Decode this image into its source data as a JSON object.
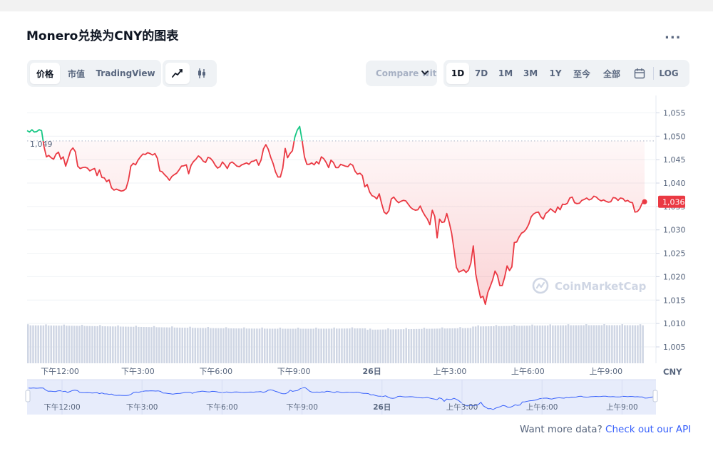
{
  "header": {
    "title": "Monero兑换为CNY的图表",
    "more_label": "..."
  },
  "toolbar": {
    "data_tabs": [
      "价格",
      "市值",
      "TradingView"
    ],
    "compare_label": "Compare with",
    "ranges": [
      "1D",
      "7D",
      "1M",
      "3M",
      "1Y",
      "至今",
      "全部"
    ],
    "log_label": "LOG"
  },
  "footer": {
    "text": "Want more data? ",
    "link": "Check out our API"
  },
  "colors": {
    "down": "#ea3943",
    "up": "#16c784",
    "brand": "#3861fb"
  },
  "chart_data": {
    "type": "line",
    "x_ticks": [
      "下午12:00",
      "下午3:00",
      "下午6:00",
      "下午9:00",
      "26日",
      "上午3:00",
      "上午6:00",
      "上午9:00"
    ],
    "y_ticks": [
      1055,
      1050,
      1045,
      1040,
      1035,
      1030,
      1025,
      1020,
      1015,
      1010,
      1005
    ],
    "ylim": [
      1001.5,
      1057.5
    ],
    "currency_label": "CNY",
    "reference_price": 1049,
    "reference_label": "1,049",
    "current_price": 1036,
    "current_label": "1,036",
    "watermark": "CoinMarketCap",
    "grid": true,
    "series": [
      {
        "values": [
          1051.2,
          1050.9,
          1051.4,
          1050.9,
          1051.0,
          1051.4,
          1051.2,
          1047.8,
          1045.6,
          1045.9,
          1045.4,
          1045.1,
          1046.2,
          1046.6,
          1045.1,
          1045.6,
          1043.6,
          1045.2,
          1046.9,
          1047.5,
          1046.7,
          1043.6,
          1043.1,
          1043.3,
          1043.4,
          1043.2,
          1042.6,
          1042.9,
          1043.1,
          1041.6,
          1042.8,
          1041.2,
          1041.1,
          1040.3,
          1040.7,
          1039.0,
          1038.5,
          1038.7,
          1038.5,
          1038.3,
          1038.4,
          1038.8,
          1040.6,
          1043.6,
          1044.2,
          1043.9,
          1044.9,
          1045.6,
          1046.2,
          1046.1,
          1046.5,
          1046.3,
          1046.0,
          1046.3,
          1045.3,
          1042.6,
          1042.4,
          1041.8,
          1041.3,
          1040.6,
          1041.4,
          1041.8,
          1042.1,
          1042.8,
          1043.6,
          1043.7,
          1043.9,
          1042.0,
          1043.8,
          1044.6,
          1045.1,
          1045.8,
          1045.4,
          1044.7,
          1044.4,
          1045.5,
          1045.3,
          1044.7,
          1043.8,
          1043.2,
          1043.5,
          1044.5,
          1043.9,
          1043.1,
          1044.2,
          1044.5,
          1044.1,
          1043.6,
          1043.5,
          1043.9,
          1044.1,
          1044.3,
          1044.0,
          1044.6,
          1044.7,
          1045.0,
          1043.8,
          1044.9,
          1047.3,
          1048.2,
          1047.2,
          1045.5,
          1044.2,
          1042.4,
          1041.3,
          1041.3,
          1043.2,
          1047.4,
          1045.4,
          1046.3,
          1046.9,
          1049.8,
          1051.3,
          1052.1,
          1049.2,
          1045.6,
          1044.0,
          1044.0,
          1044.3,
          1043.9,
          1044.6,
          1044.1,
          1045.6,
          1045.2,
          1044.4,
          1043.3,
          1044.9,
          1044.4,
          1043.3,
          1043.3,
          1044.0,
          1043.8,
          1043.6,
          1043.5,
          1044.1,
          1043.8,
          1042.5,
          1041.9,
          1042.1,
          1041.6,
          1039.2,
          1039.7,
          1038.1,
          1037.3,
          1037.1,
          1036.6,
          1037.7,
          1035.6,
          1033.8,
          1033.4,
          1034.1,
          1036.6,
          1037.0,
          1036.3,
          1035.8,
          1036.1,
          1036.3,
          1036.2,
          1035.5,
          1034.8,
          1034.4,
          1034.2,
          1034.3,
          1035.1,
          1033.9,
          1033.0,
          1032.3,
          1031.1,
          1034.2,
          1032.9,
          1028.3,
          1032.3,
          1031.6,
          1031.7,
          1033.5,
          1031.6,
          1029.3,
          1025.7,
          1022.0,
          1021.0,
          1021.2,
          1021.5,
          1020.9,
          1021.4,
          1022.9,
          1026.6,
          1020.6,
          1017.9,
          1015.5,
          1015.8,
          1014.1,
          1016.6,
          1017.9,
          1019.3,
          1021.2,
          1020.3,
          1018.1,
          1018.1,
          1019.9,
          1022.3,
          1021.3,
          1022.1,
          1027.3,
          1027.4,
          1028.5,
          1029.3,
          1029.6,
          1030.2,
          1031.2,
          1032.8,
          1033.4,
          1033.7,
          1033.8,
          1032.8,
          1032.3,
          1033.5,
          1033.9,
          1034.5,
          1034.1,
          1033.7,
          1034.9,
          1034.3,
          1035.5,
          1035.4,
          1035.7,
          1036.8,
          1037.0,
          1035.8,
          1035.6,
          1035.7,
          1036.3,
          1036.5,
          1036.8,
          1036.4,
          1036.6,
          1037.2,
          1037.0,
          1036.5,
          1036.2,
          1036.4,
          1036.1,
          1035.9,
          1036.0,
          1036.9,
          1036.8,
          1036.3,
          1036.8,
          1036.7,
          1036.1,
          1036.3,
          1035.9,
          1035.8,
          1033.8,
          1033.9,
          1034.5,
          1035.7,
          1036.0
        ]
      }
    ]
  }
}
